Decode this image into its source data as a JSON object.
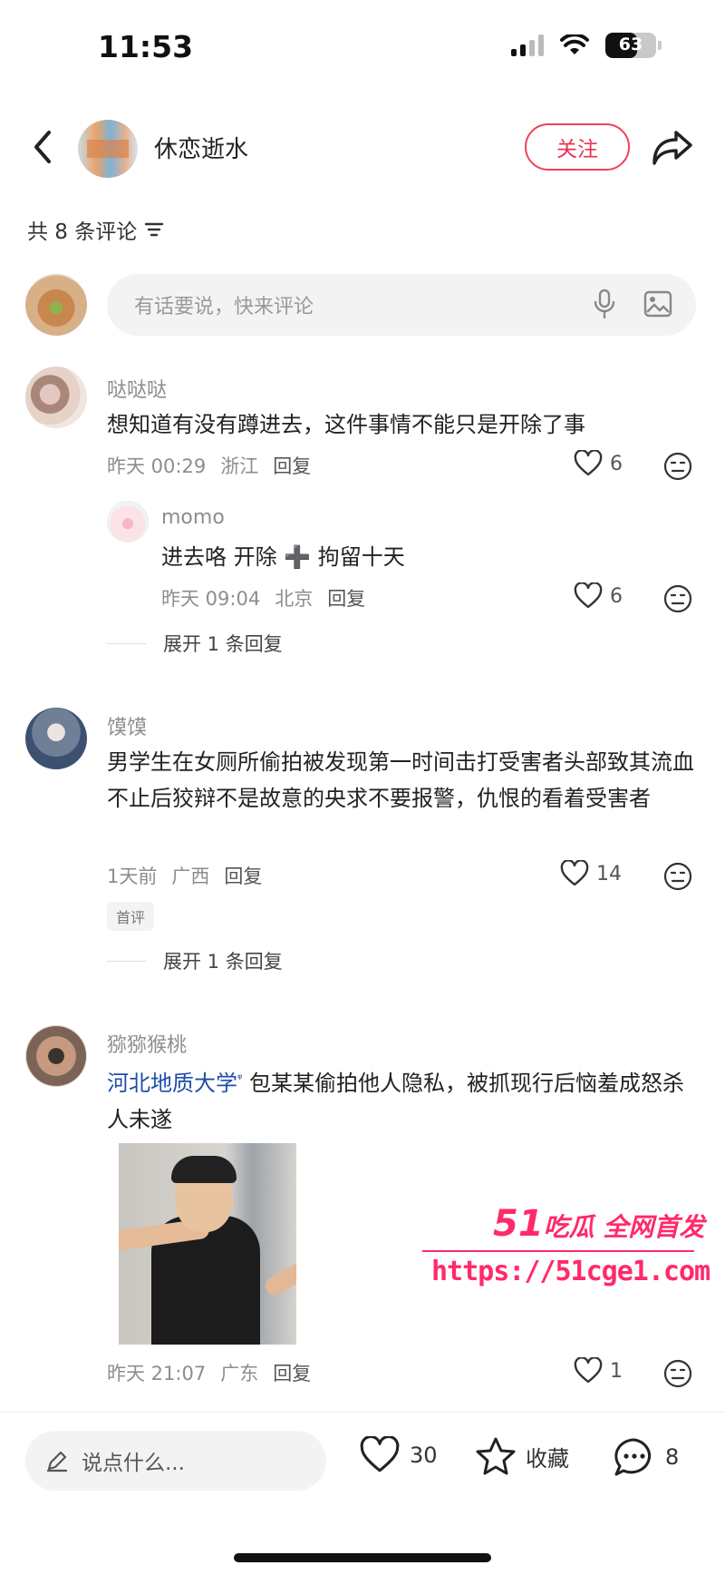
{
  "status_bar": {
    "time": "11:53",
    "battery": "63",
    "battery_level": 0.63
  },
  "header": {
    "author_name": "休恋逝水",
    "follow_label": "关注"
  },
  "comments_header": {
    "count_text": "共 8 条评论"
  },
  "compose": {
    "placeholder": "有话要说，快来评论"
  },
  "comments": [
    {
      "user": "哒哒哒",
      "text": "想知道有没有蹲进去，这件事情不能只是开除了事",
      "time": "昨天 00:29",
      "location": "浙江",
      "reply_label": "回复",
      "likes": "6",
      "replies": [
        {
          "user": "momo",
          "text": "进去咯 开除 ➕ 拘留十天",
          "time": "昨天 09:04",
          "location": "北京",
          "reply_label": "回复",
          "likes": "6"
        }
      ],
      "expand_text": "展开 1 条回复"
    },
    {
      "user": "馍馍",
      "text": "男学生在女厕所偷拍被发现第一时间击打受害者头部致其流血不止后狡辩不是故意的央求不要报警，仇恨的看着受害者",
      "time": "1天前",
      "location": "广西",
      "reply_label": "回复",
      "likes": "14",
      "badge": "首评",
      "expand_text": "展开 1 条回复"
    },
    {
      "user": "猕猕猴桃",
      "mention": "河北地质大学",
      "text": " 包某某偷拍他人隐私，被抓现行后恼羞成怒杀人未遂",
      "time": "昨天 21:07",
      "location": "广东",
      "reply_label": "回复",
      "likes": "1"
    }
  ],
  "watermark": {
    "title_num": "51",
    "title_text": "吃瓜 全网首发",
    "url": "https://51cge1.com"
  },
  "bottom_bar": {
    "input_placeholder": "说点什么...",
    "likes": "30",
    "collect_label": "收藏",
    "comments": "8"
  },
  "colors": {
    "accent": "#ee3150",
    "mention": "#1f4ea8",
    "watermark": "#ff2a6a"
  }
}
